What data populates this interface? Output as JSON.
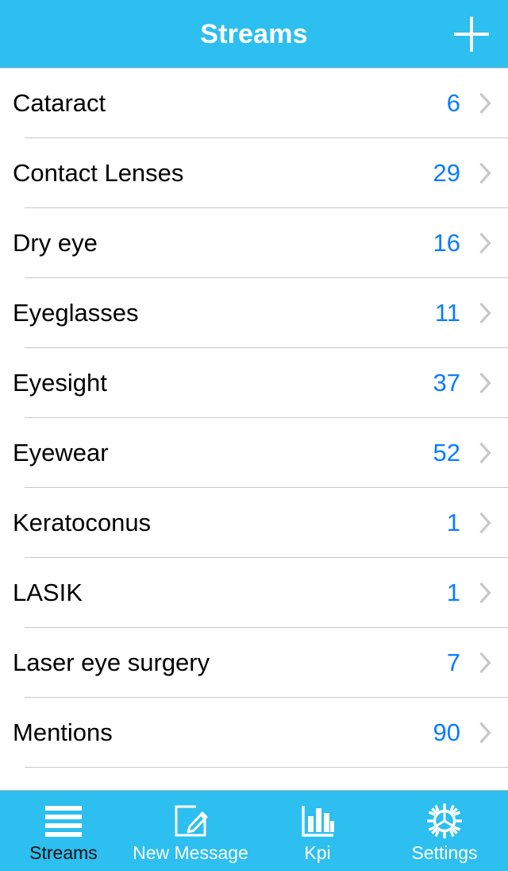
{
  "header": {
    "title": "Streams",
    "add_icon": "plus-icon",
    "background_color": "#2CBFEF",
    "title_color": "#FFFFFF"
  },
  "list": {
    "count_color": "#0A7CFF",
    "chevron_icon": "chevron-right-icon",
    "rows": [
      {
        "label": "Cataract",
        "count": "6"
      },
      {
        "label": "Contact Lenses",
        "count": "29"
      },
      {
        "label": "Dry eye",
        "count": "16"
      },
      {
        "label": "Eyeglasses",
        "count": "11"
      },
      {
        "label": "Eyesight",
        "count": "37"
      },
      {
        "label": "Eyewear",
        "count": "52"
      },
      {
        "label": "Keratoconus",
        "count": "1"
      },
      {
        "label": "LASIK",
        "count": "1"
      },
      {
        "label": "Laser eye surgery",
        "count": "7"
      },
      {
        "label": "Mentions",
        "count": "90"
      }
    ]
  },
  "tabbar": {
    "background_color": "#2CBFEF",
    "active_label_color": "#111111",
    "inactive_label_color": "#FFFFFF",
    "tabs": [
      {
        "label": "Streams",
        "icon": "list-lines-icon",
        "active": true
      },
      {
        "label": "New Message",
        "icon": "compose-icon",
        "active": false
      },
      {
        "label": "Kpi",
        "icon": "bar-chart-icon",
        "active": false
      },
      {
        "label": "Settings",
        "icon": "gear-icon",
        "active": false
      }
    ]
  }
}
